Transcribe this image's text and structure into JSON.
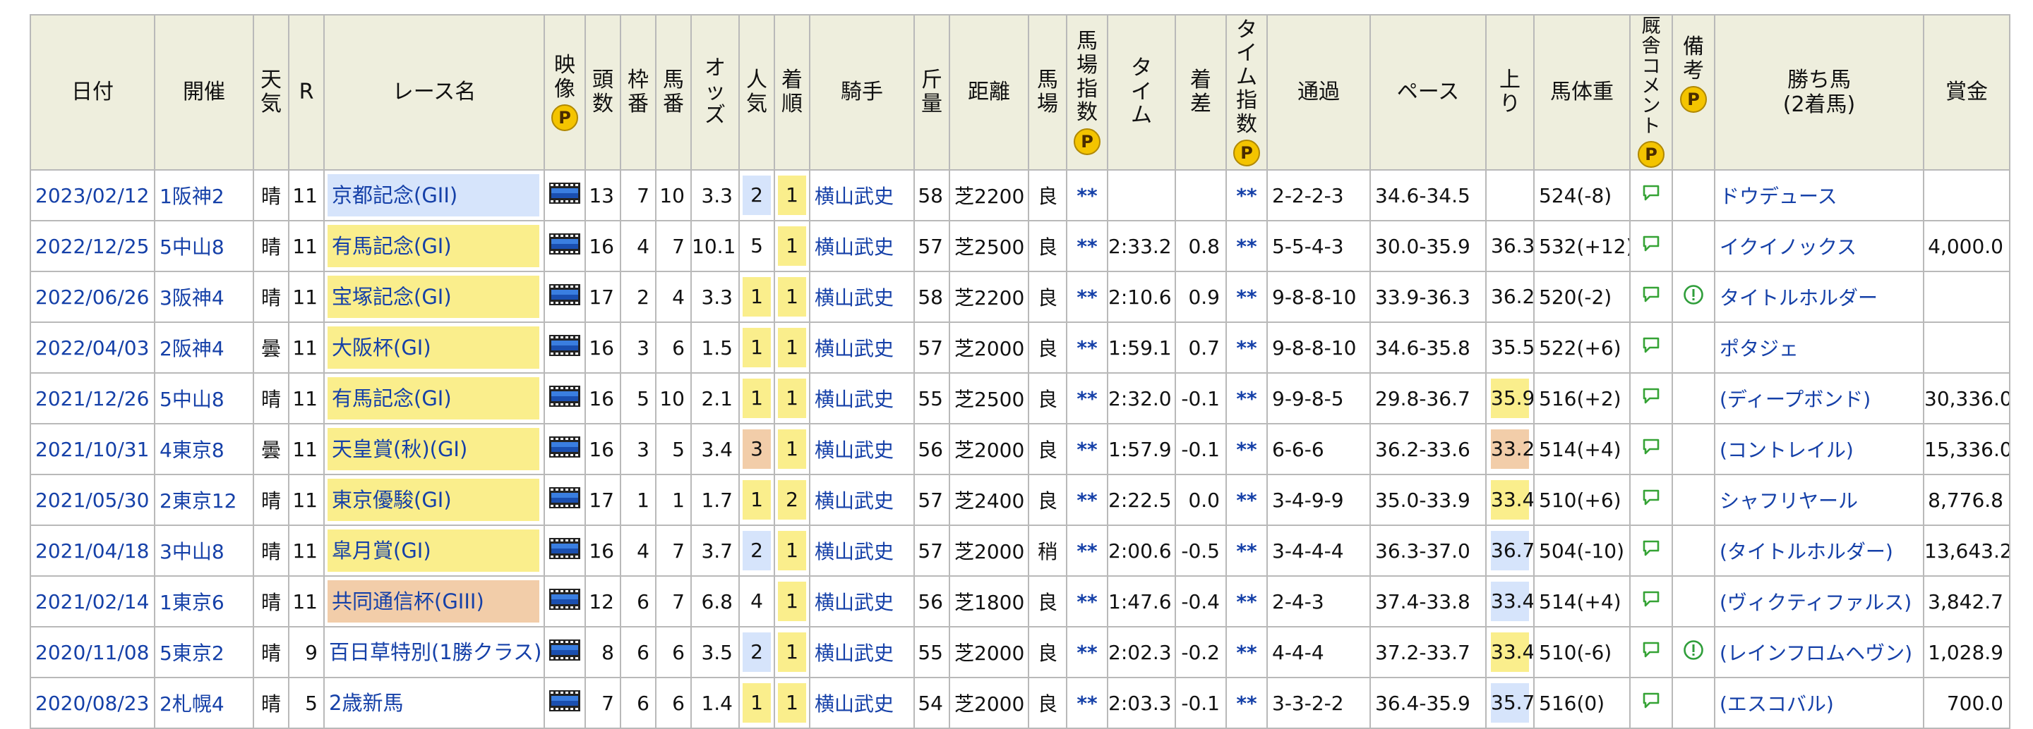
{
  "headers": {
    "date": "日付",
    "venue": "開催",
    "weather": "天気",
    "r": "R",
    "race_name": "レース名",
    "video": "映像",
    "heads": "頭数",
    "frame": "枠番",
    "horse_no": "馬番",
    "odds": "オッズ",
    "popularity": "人気",
    "finish": "着順",
    "jockey": "騎手",
    "weight_carried": "斤量",
    "distance": "距離",
    "track": "馬場",
    "track_index": "馬場指数",
    "time": "タイム",
    "margin": "着差",
    "time_index": "タイム指数",
    "passing": "通過",
    "pace": "ペース",
    "last3f": "上り",
    "body_weight": "馬体重",
    "stable_comment": "厩舎コメント",
    "remarks": "備考",
    "winner_line1": "勝ち馬",
    "winner_line2": "(2着馬)",
    "prize": "賞金",
    "premium_badge": "P"
  },
  "colors": {
    "header_bg": "#eeeedd",
    "link": "#1540a8",
    "grade_blue": "#d6e4fb",
    "grade_yellow": "#faee8c",
    "grade_orange": "#f2cda9",
    "popularity_blue": "#d6e4fb",
    "popularity_yellow": "#faee8c",
    "popularity_orange": "#f2cda9",
    "badge_gold": "#f4c400",
    "comment_green": "#35a335",
    "remark_green": "#2f9e3a"
  },
  "rows": [
    {
      "date": "2023/02/12",
      "venue": "1阪神2",
      "weather": "晴",
      "r": "11",
      "race": "京都記念(GII)",
      "race_bg": "blue",
      "heads": "13",
      "frame": "7",
      "horse_no": "10",
      "odds": "3.3",
      "pop": "2",
      "pop_bg": "blue",
      "finish": "1",
      "jockey": "横山武史",
      "kinryo": "58",
      "distance": "芝2200",
      "track": "良",
      "track_index": "**",
      "time": "",
      "margin": "",
      "time_index": "**",
      "passing": "2-2-2-3",
      "pace": "34.6-34.5",
      "last3f": "",
      "last3f_bg": "",
      "body_weight": "524(-8)",
      "remark": false,
      "winner": "ドウデュース",
      "prize": ""
    },
    {
      "date": "2022/12/25",
      "venue": "5中山8",
      "weather": "晴",
      "r": "11",
      "race": "有馬記念(GI)",
      "race_bg": "yellow",
      "heads": "16",
      "frame": "4",
      "horse_no": "7",
      "odds": "10.1",
      "pop": "5",
      "pop_bg": "",
      "finish": "1",
      "jockey": "横山武史",
      "kinryo": "57",
      "distance": "芝2500",
      "track": "良",
      "track_index": "**",
      "time": "2:33.2",
      "margin": "0.8",
      "time_index": "**",
      "passing": "5-5-4-3",
      "pace": "30.0-35.9",
      "last3f": "36.3",
      "last3f_bg": "",
      "body_weight": "532(+12)",
      "remark": false,
      "winner": "イクイノックス",
      "prize": "4,000.0"
    },
    {
      "date": "2022/06/26",
      "venue": "3阪神4",
      "weather": "晴",
      "r": "11",
      "race": "宝塚記念(GI)",
      "race_bg": "yellow",
      "heads": "17",
      "frame": "2",
      "horse_no": "4",
      "odds": "3.3",
      "pop": "1",
      "pop_bg": "yellow",
      "finish": "1",
      "jockey": "横山武史",
      "kinryo": "58",
      "distance": "芝2200",
      "track": "良",
      "track_index": "**",
      "time": "2:10.6",
      "margin": "0.9",
      "time_index": "**",
      "passing": "9-8-8-10",
      "pace": "33.9-36.3",
      "last3f": "36.2",
      "last3f_bg": "",
      "body_weight": "520(-2)",
      "remark": true,
      "winner": "タイトルホルダー",
      "prize": ""
    },
    {
      "date": "2022/04/03",
      "venue": "2阪神4",
      "weather": "曇",
      "r": "11",
      "race": "大阪杯(GI)",
      "race_bg": "yellow",
      "heads": "16",
      "frame": "3",
      "horse_no": "6",
      "odds": "1.5",
      "pop": "1",
      "pop_bg": "yellow",
      "finish": "1",
      "jockey": "横山武史",
      "kinryo": "57",
      "distance": "芝2000",
      "track": "良",
      "track_index": "**",
      "time": "1:59.1",
      "margin": "0.7",
      "time_index": "**",
      "passing": "9-8-8-10",
      "pace": "34.6-35.8",
      "last3f": "35.5",
      "last3f_bg": "",
      "body_weight": "522(+6)",
      "remark": false,
      "winner": "ポタジェ",
      "prize": ""
    },
    {
      "date": "2021/12/26",
      "venue": "5中山8",
      "weather": "晴",
      "r": "11",
      "race": "有馬記念(GI)",
      "race_bg": "yellow",
      "heads": "16",
      "frame": "5",
      "horse_no": "10",
      "odds": "2.1",
      "pop": "1",
      "pop_bg": "yellow",
      "finish": "1",
      "jockey": "横山武史",
      "kinryo": "55",
      "distance": "芝2500",
      "track": "良",
      "track_index": "**",
      "time": "2:32.0",
      "margin": "-0.1",
      "time_index": "**",
      "passing": "9-9-8-5",
      "pace": "29.8-36.7",
      "last3f": "35.9",
      "last3f_bg": "yellow",
      "body_weight": "516(+2)",
      "remark": false,
      "winner": "(ディープボンド)",
      "prize": "30,336.0"
    },
    {
      "date": "2021/10/31",
      "venue": "4東京8",
      "weather": "曇",
      "r": "11",
      "race": "天皇賞(秋)(GI)",
      "race_bg": "yellow",
      "heads": "16",
      "frame": "3",
      "horse_no": "5",
      "odds": "3.4",
      "pop": "3",
      "pop_bg": "orange",
      "finish": "1",
      "jockey": "横山武史",
      "kinryo": "56",
      "distance": "芝2000",
      "track": "良",
      "track_index": "**",
      "time": "1:57.9",
      "margin": "-0.1",
      "time_index": "**",
      "passing": "6-6-6",
      "pace": "36.2-33.6",
      "last3f": "33.2",
      "last3f_bg": "orange",
      "body_weight": "514(+4)",
      "remark": false,
      "winner": "(コントレイル)",
      "prize": "15,336.0"
    },
    {
      "date": "2021/05/30",
      "venue": "2東京12",
      "weather": "晴",
      "r": "11",
      "race": "東京優駿(GI)",
      "race_bg": "yellow",
      "heads": "17",
      "frame": "1",
      "horse_no": "1",
      "odds": "1.7",
      "pop": "1",
      "pop_bg": "yellow",
      "finish": "2",
      "jockey": "横山武史",
      "kinryo": "57",
      "distance": "芝2400",
      "track": "良",
      "track_index": "**",
      "time": "2:22.5",
      "margin": "0.0",
      "time_index": "**",
      "passing": "3-4-9-9",
      "pace": "35.0-33.9",
      "last3f": "33.4",
      "last3f_bg": "yellow",
      "body_weight": "510(+6)",
      "remark": false,
      "winner": "シャフリヤール",
      "prize": "8,776.8"
    },
    {
      "date": "2021/04/18",
      "venue": "3中山8",
      "weather": "晴",
      "r": "11",
      "race": "皐月賞(GI)",
      "race_bg": "yellow",
      "heads": "16",
      "frame": "4",
      "horse_no": "7",
      "odds": "3.7",
      "pop": "2",
      "pop_bg": "blue",
      "finish": "1",
      "jockey": "横山武史",
      "kinryo": "57",
      "distance": "芝2000",
      "track": "稍",
      "track_index": "**",
      "time": "2:00.6",
      "margin": "-0.5",
      "time_index": "**",
      "passing": "3-4-4-4",
      "pace": "36.3-37.0",
      "last3f": "36.7",
      "last3f_bg": "blue",
      "body_weight": "504(-10)",
      "remark": false,
      "winner": "(タイトルホルダー)",
      "prize": "13,643.2"
    },
    {
      "date": "2021/02/14",
      "venue": "1東京6",
      "weather": "晴",
      "r": "11",
      "race": "共同通信杯(GIII)",
      "race_bg": "orange",
      "heads": "12",
      "frame": "6",
      "horse_no": "7",
      "odds": "6.8",
      "pop": "4",
      "pop_bg": "",
      "finish": "1",
      "jockey": "横山武史",
      "kinryo": "56",
      "distance": "芝1800",
      "track": "良",
      "track_index": "**",
      "time": "1:47.6",
      "margin": "-0.4",
      "time_index": "**",
      "passing": "2-4-3",
      "pace": "37.4-33.8",
      "last3f": "33.4",
      "last3f_bg": "blue",
      "body_weight": "514(+4)",
      "remark": false,
      "winner": "(ヴィクティファルス)",
      "prize": "3,842.7"
    },
    {
      "date": "2020/11/08",
      "venue": "5東京2",
      "weather": "晴",
      "r": "9",
      "race": "百日草特別(1勝クラス)",
      "race_bg": "",
      "heads": "8",
      "frame": "6",
      "horse_no": "6",
      "odds": "3.5",
      "pop": "2",
      "pop_bg": "blue",
      "finish": "1",
      "jockey": "横山武史",
      "kinryo": "55",
      "distance": "芝2000",
      "track": "良",
      "track_index": "**",
      "time": "2:02.3",
      "margin": "-0.2",
      "time_index": "**",
      "passing": "4-4-4",
      "pace": "37.2-33.7",
      "last3f": "33.4",
      "last3f_bg": "yellow",
      "body_weight": "510(-6)",
      "remark": true,
      "winner": "(レインフロムヘヴン)",
      "prize": "1,028.9"
    },
    {
      "date": "2020/08/23",
      "venue": "2札幌4",
      "weather": "晴",
      "r": "5",
      "race": "2歳新馬",
      "race_bg": "",
      "heads": "7",
      "frame": "6",
      "horse_no": "6",
      "odds": "1.4",
      "pop": "1",
      "pop_bg": "yellow",
      "finish": "1",
      "jockey": "横山武史",
      "kinryo": "54",
      "distance": "芝2000",
      "track": "良",
      "track_index": "**",
      "time": "2:03.3",
      "margin": "-0.1",
      "time_index": "**",
      "passing": "3-3-2-2",
      "pace": "36.4-35.9",
      "last3f": "35.7",
      "last3f_bg": "blue",
      "body_weight": "516(0)",
      "remark": false,
      "winner": "(エスコバル)",
      "prize": "700.0"
    }
  ]
}
